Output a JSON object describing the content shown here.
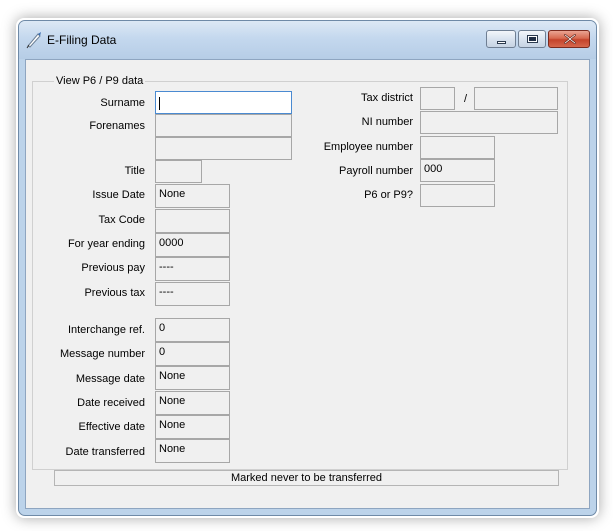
{
  "window": {
    "title": "E-Filing Data"
  },
  "group": {
    "legend": "View P6 / P9 data"
  },
  "left_fields": {
    "surname": {
      "label": "Surname",
      "value": ""
    },
    "forenames": {
      "label": "Forenames",
      "value": "",
      "value2": ""
    },
    "title": {
      "label": "Title",
      "value": ""
    },
    "issue_date": {
      "label": "Issue Date",
      "value": "None"
    },
    "tax_code": {
      "label": "Tax Code",
      "value": ""
    },
    "year_ending": {
      "label": "For year ending",
      "value": "0000"
    },
    "previous_pay": {
      "label": "Previous pay",
      "value": "----"
    },
    "previous_tax": {
      "label": "Previous tax",
      "value": "----"
    },
    "interchange_ref": {
      "label": "Interchange ref.",
      "value": "0"
    },
    "message_number": {
      "label": "Message number",
      "value": "0"
    },
    "message_date": {
      "label": "Message date",
      "value": "None"
    },
    "date_received": {
      "label": "Date received",
      "value": "None"
    },
    "effective_date": {
      "label": "Effective date",
      "value": "None"
    },
    "date_transferred": {
      "label": "Date transferred",
      "value": "None"
    }
  },
  "right_fields": {
    "tax_district": {
      "label": "Tax district",
      "value1": "",
      "separator": "/",
      "value2": ""
    },
    "ni_number": {
      "label": "NI number",
      "value": ""
    },
    "employee_number": {
      "label": "Employee number",
      "value": ""
    },
    "payroll_number": {
      "label": "Payroll number",
      "value": "000"
    },
    "p6_or_p9": {
      "label": "P6 or P9?",
      "value": ""
    }
  },
  "status": {
    "text": "Marked never to be transferred"
  },
  "icons": {
    "app": "quill-pen-icon",
    "minimize": "minimize-icon",
    "maximize": "maximize-icon",
    "close": "close-icon"
  }
}
